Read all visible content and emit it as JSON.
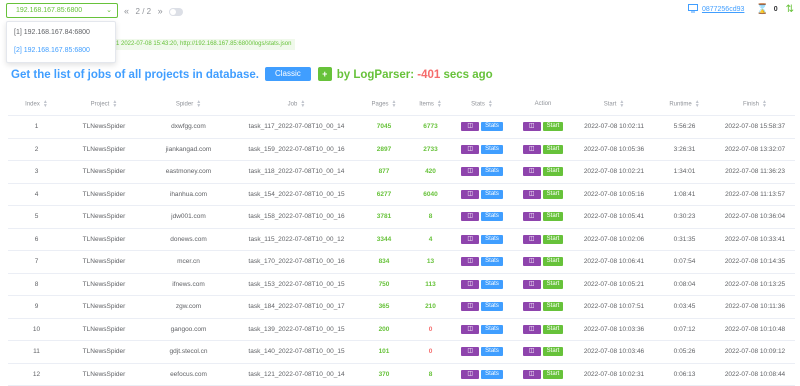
{
  "topbar": {
    "server_value": "192.168.167.85:6800",
    "pager_first": "«",
    "pager_text": "2 / 2",
    "pager_last": "»",
    "token": "0877256cd93",
    "count": "0"
  },
  "dropdown": {
    "options": [
      "[1] 192.168.167.84:6800",
      "[2] 192.168.167.85:6800"
    ]
  },
  "info_bar": "1 2022-07-08 15:43:20, http://192.168.167.85:6800/logs/stats.json",
  "heading": {
    "text": "Get the list of jobs of all projects in database.",
    "classic_label": "Classic",
    "plus_label": "+",
    "by_text": "by LogParser:",
    "secs_value": "-401",
    "ago_text": "secs ago"
  },
  "table": {
    "headers": [
      "Index",
      "Project",
      "Spider",
      "Job",
      "Pages",
      "Items",
      "Stats",
      "Action",
      "Start",
      "Runtime",
      "Finish"
    ],
    "stats_label": "Stats",
    "start_label": "Start",
    "rows": [
      {
        "index": "1",
        "project": "TLNewsSpider",
        "spider": "dxwfgg.com",
        "job": "task_117_2022-07-08T10_00_14",
        "pages": "7045",
        "items": "6773",
        "start": "2022-07-08 10:02:11",
        "runtime": "5:56:26",
        "finish": "2022-07-08 15:58:37",
        "items_red": false
      },
      {
        "index": "2",
        "project": "TLNewsSpider",
        "spider": "jiankangad.com",
        "job": "task_159_2022-07-08T10_00_16",
        "pages": "2897",
        "items": "2733",
        "start": "2022-07-08 10:05:36",
        "runtime": "3:26:31",
        "finish": "2022-07-08 13:32:07",
        "items_red": false
      },
      {
        "index": "3",
        "project": "TLNewsSpider",
        "spider": "eastmoney.com",
        "job": "task_118_2022-07-08T10_00_14",
        "pages": "877",
        "items": "420",
        "start": "2022-07-08 10:02:21",
        "runtime": "1:34:01",
        "finish": "2022-07-08 11:36:23",
        "items_red": false
      },
      {
        "index": "4",
        "project": "TLNewsSpider",
        "spider": "ihanhua.com",
        "job": "task_154_2022-07-08T10_00_15",
        "pages": "6277",
        "items": "6040",
        "start": "2022-07-08 10:05:16",
        "runtime": "1:08:41",
        "finish": "2022-07-08 11:13:57",
        "items_red": false
      },
      {
        "index": "5",
        "project": "TLNewsSpider",
        "spider": "jdw001.com",
        "job": "task_158_2022-07-08T10_00_16",
        "pages": "3781",
        "items": "8",
        "start": "2022-07-08 10:05:41",
        "runtime": "0:30:23",
        "finish": "2022-07-08 10:36:04",
        "items_red": false
      },
      {
        "index": "6",
        "project": "TLNewsSpider",
        "spider": "donews.com",
        "job": "task_115_2022-07-08T10_00_12",
        "pages": "3344",
        "items": "4",
        "start": "2022-07-08 10:02:06",
        "runtime": "0:31:35",
        "finish": "2022-07-08 10:33:41",
        "items_red": false
      },
      {
        "index": "7",
        "project": "TLNewsSpider",
        "spider": "mcer.cn",
        "job": "task_170_2022-07-08T10_00_16",
        "pages": "834",
        "items": "13",
        "start": "2022-07-08 10:06:41",
        "runtime": "0:07:54",
        "finish": "2022-07-08 10:14:35",
        "items_red": false
      },
      {
        "index": "8",
        "project": "TLNewsSpider",
        "spider": "ifnews.com",
        "job": "task_153_2022-07-08T10_00_15",
        "pages": "750",
        "items": "113",
        "start": "2022-07-08 10:05:21",
        "runtime": "0:08:04",
        "finish": "2022-07-08 10:13:25",
        "items_red": false
      },
      {
        "index": "9",
        "project": "TLNewsSpider",
        "spider": "zgw.com",
        "job": "task_184_2022-07-08T10_00_17",
        "pages": "365",
        "items": "210",
        "start": "2022-07-08 10:07:51",
        "runtime": "0:03:45",
        "finish": "2022-07-08 10:11:36",
        "items_red": false
      },
      {
        "index": "10",
        "project": "TLNewsSpider",
        "spider": "gangoo.com",
        "job": "task_139_2022-07-08T10_00_15",
        "pages": "200",
        "items": "0",
        "start": "2022-07-08 10:03:36",
        "runtime": "0:07:12",
        "finish": "2022-07-08 10:10:48",
        "items_red": true
      },
      {
        "index": "11",
        "project": "TLNewsSpider",
        "spider": "gdjt.stecol.cn",
        "job": "task_140_2022-07-08T10_00_15",
        "pages": "101",
        "items": "0",
        "start": "2022-07-08 10:03:46",
        "runtime": "0:05:26",
        "finish": "2022-07-08 10:09:12",
        "items_red": true
      },
      {
        "index": "12",
        "project": "TLNewsSpider",
        "spider": "eefocus.com",
        "job": "task_121_2022-07-08T10_00_14",
        "pages": "370",
        "items": "8",
        "start": "2022-07-08 10:02:31",
        "runtime": "0:06:13",
        "finish": "2022-07-08 10:08:44",
        "items_red": false
      }
    ]
  },
  "colors": {
    "primary": "#409eff",
    "success": "#67c23a",
    "danger": "#f56c6c",
    "purple": "#8e44ad"
  },
  "icons": [
    "chevron-down-icon",
    "monitor-icon",
    "hourglass-icon",
    "sort-arrows-icon",
    "sitemap-icon",
    "up-down-arrow-icon"
  ]
}
